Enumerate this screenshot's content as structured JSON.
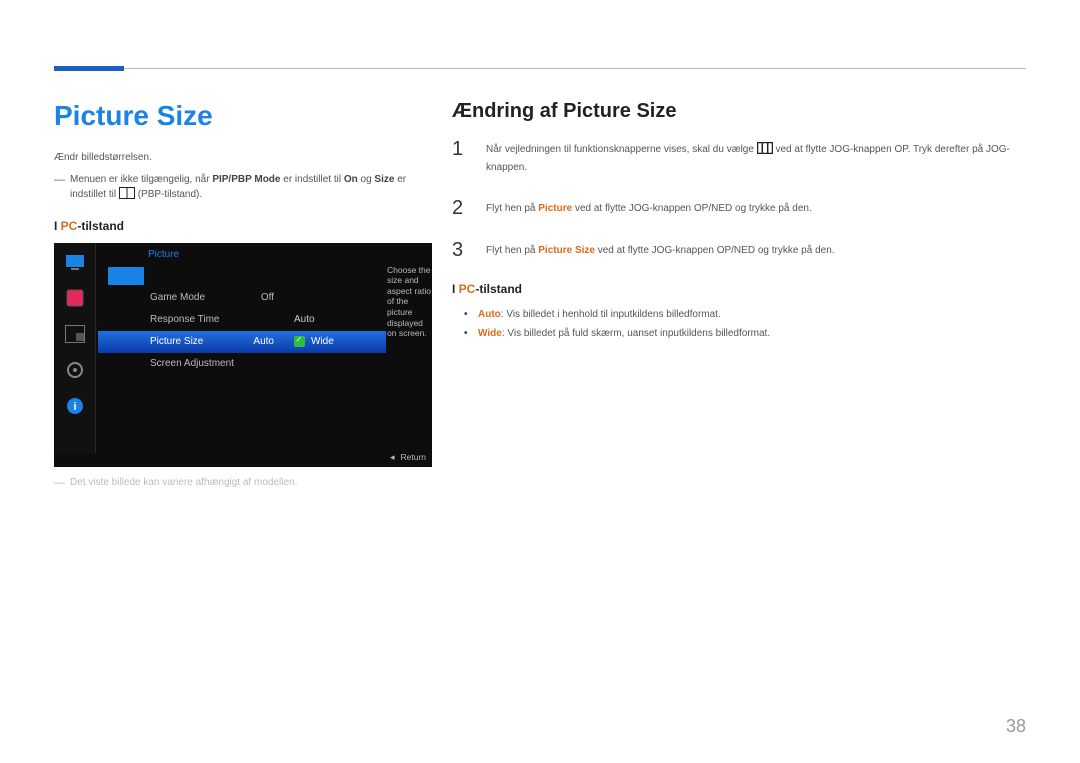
{
  "left": {
    "title": "Picture Size",
    "intro": "Ændr billedstørrelsen.",
    "note_pre": "Menuen er ikke tilgængelig, når ",
    "note_b1": "PIP/PBP Mode",
    "note_mid1": " er indstillet til ",
    "note_b2": "On",
    "note_mid2": " og ",
    "note_b3": "Size",
    "note_mid3": " er indstillet til ",
    "note_post": " (PBP-tilstand).",
    "sub_h_pre": "I ",
    "sub_h_pc": "PC",
    "sub_h_post": "-tilstand",
    "footnote": "Det viste billede kan variere afhængigt af modellen."
  },
  "osd": {
    "header": "Picture",
    "row1": "Game Mode",
    "row1v": "Off",
    "row2": "Response Time",
    "row3": "Picture Size",
    "row3v": "Auto",
    "row4": "Screen Adjustment",
    "sub1": "Auto",
    "sub2": "Wide",
    "help": "Choose the size and aspect ratio of the picture displayed on screen.",
    "return": "Return"
  },
  "right": {
    "title": "Ændring af Picture Size",
    "step1_pre": "Når vejledningen til funktionsknapperne vises, skal du vælge ",
    "step1_post": " ved at flytte JOG-knappen OP. Tryk derefter på JOG-knappen.",
    "step2_pre": "Flyt hen på ",
    "step2_a": "Picture",
    "step2_post": " ved at flytte JOG-knappen OP/NED og trykke på den.",
    "step3_pre": "Flyt hen på ",
    "step3_a": "Picture Size",
    "step3_post": " ved at flytte JOG-knappen OP/NED og trykke på den.",
    "sub_h_pre": "I ",
    "sub_h_pc": "PC",
    "sub_h_post": "-tilstand",
    "b1a": "Auto",
    "b1t": ": Vis billedet i henhold til inputkildens billedformat.",
    "b2a": "Wide",
    "b2t": ": Vis billedet på fuld skærm, uanset inputkildens billedformat."
  },
  "page": "38"
}
